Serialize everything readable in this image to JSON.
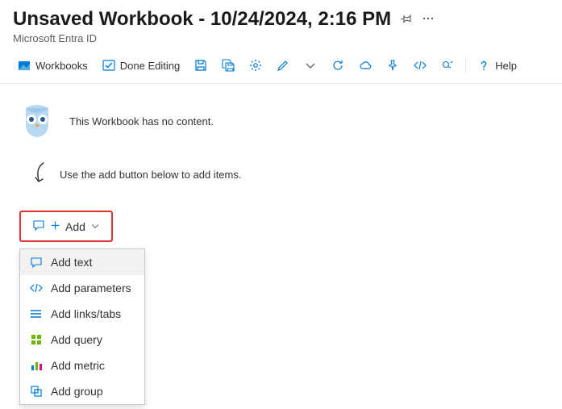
{
  "header": {
    "title": "Unsaved Workbook - 10/24/2024, 2:16 PM",
    "subtitle": "Microsoft Entra ID"
  },
  "toolbar": {
    "workbooks": "Workbooks",
    "done_editing": "Done Editing",
    "help": "Help"
  },
  "empty": {
    "message": "This Workbook has no content.",
    "hint": "Use the add button below to add items."
  },
  "add_button": {
    "label": "Add"
  },
  "menu": {
    "items": [
      {
        "label": "Add text"
      },
      {
        "label": "Add parameters"
      },
      {
        "label": "Add links/tabs"
      },
      {
        "label": "Add query"
      },
      {
        "label": "Add metric"
      },
      {
        "label": "Add group"
      }
    ]
  },
  "colors": {
    "accent": "#0078d4",
    "highlight_border": "#e03030"
  }
}
